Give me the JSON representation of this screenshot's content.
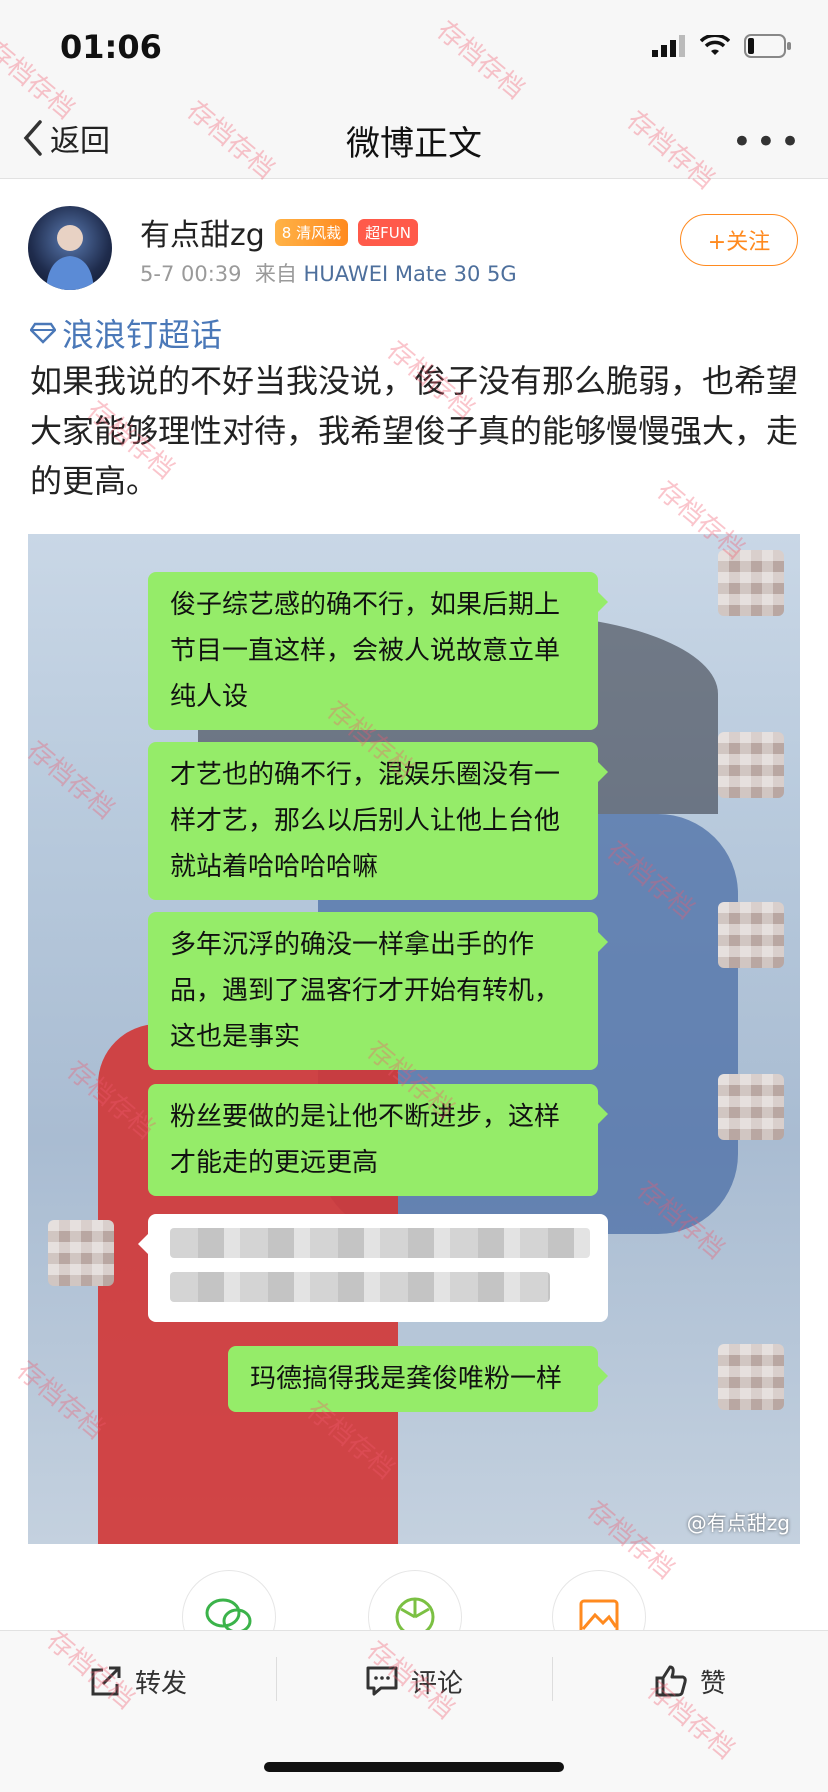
{
  "status_bar": {
    "time": "01:06"
  },
  "nav": {
    "back_label": "返回",
    "title": "微博正文",
    "more": "•••"
  },
  "author": {
    "name": "有点甜zg",
    "badge_level": "8",
    "badge_a": "清风裁",
    "badge_b": "超FUN",
    "time": "5-7 00:39",
    "from_label": "来自",
    "device": "HUAWEI Mate 30 5G",
    "follow_label": "+关注"
  },
  "post": {
    "topic": "浪浪钉超话",
    "text": "如果我说的不好当我没说，俊子没有那么脆弱，也希望大家能够理性对待，我希望俊子真的能够慢慢强大，走的更高。"
  },
  "chat": {
    "messages": [
      "俊子综艺感的确不行，如果后期上节目一直这样，会被人说故意立单纯人设",
      "才艺也的确不行，混娱乐圈没有一样才艺，那么以后别人让他上台他就站着哈哈哈哈嘛",
      "多年沉浮的确没一样拿出手的作品，遇到了温客行才开始有转机，这也是事实",
      "粉丝要做的是让他不断进步，这样才能走的更远更高",
      "玛德搞得我是龚俊唯粉一样"
    ],
    "image_watermark": "@有点甜zg"
  },
  "toolbar": {
    "repost": "转发",
    "comment": "评论",
    "like": "赞"
  },
  "overlay_watermark": "存档存档",
  "colors": {
    "accent": "#ff8a1f",
    "link": "#4a78b8",
    "bubble": "#95ec69"
  }
}
